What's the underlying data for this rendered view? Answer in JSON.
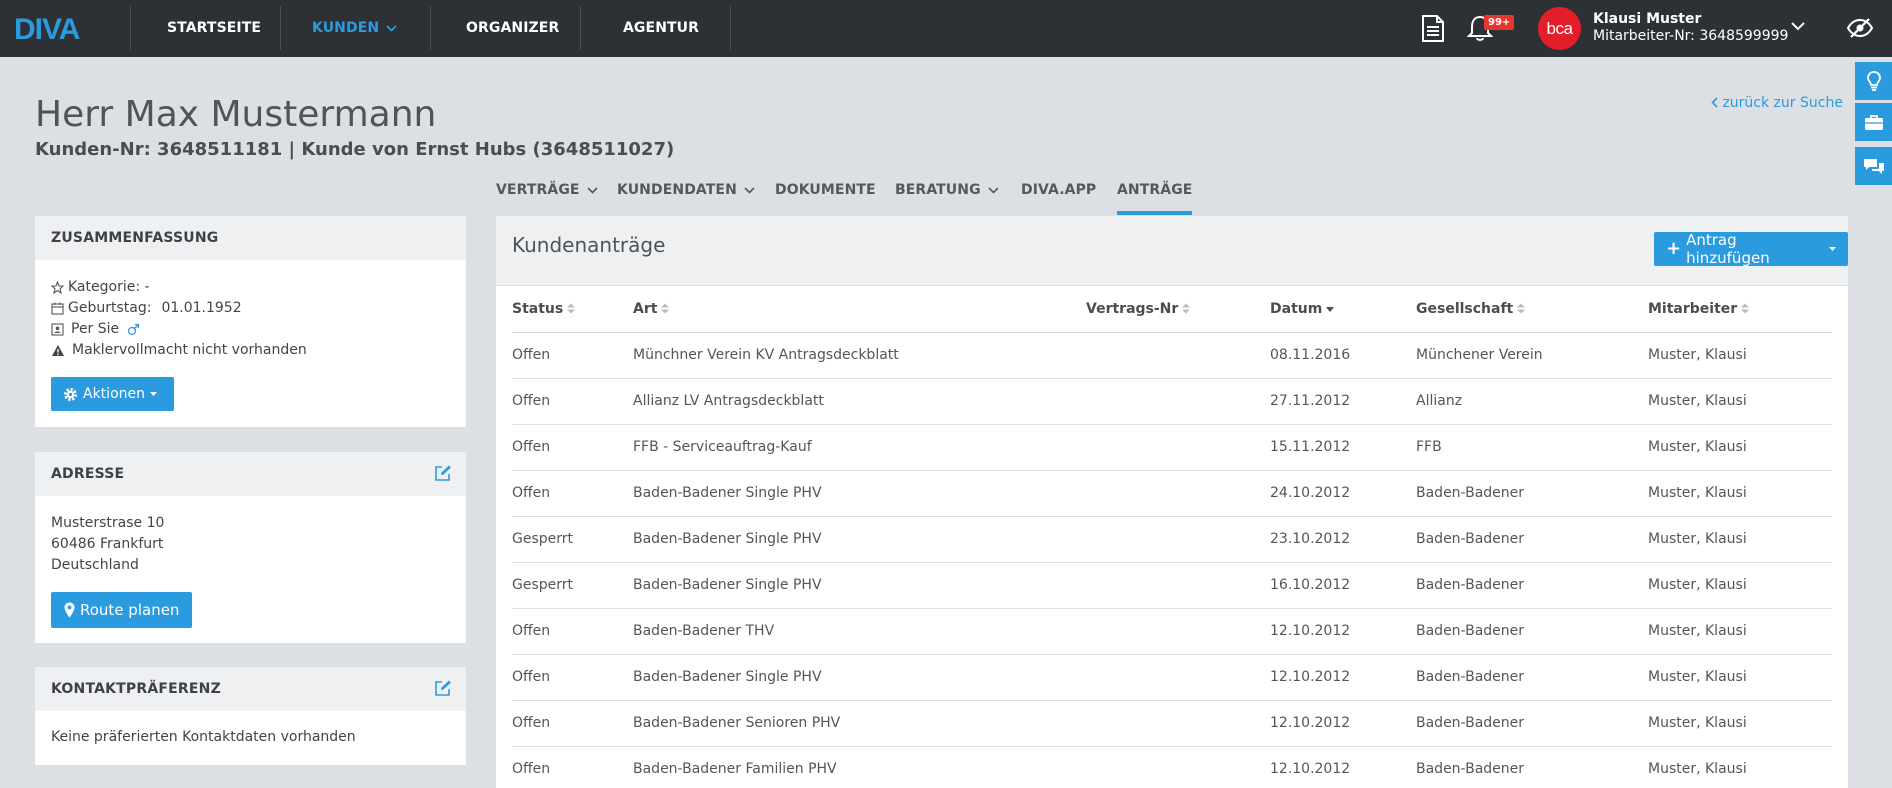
{
  "brand": {
    "logo_text": "DIVA",
    "accent": "#2b9be0",
    "topbar_bg": "#2d3136"
  },
  "nav": [
    {
      "label": "STARTSEITE"
    },
    {
      "label": "KUNDEN"
    },
    {
      "label": "ORGANIZER"
    },
    {
      "label": "AGENTUR"
    }
  ],
  "topbar": {
    "notification_badge": "99+",
    "avatar_text": "bca",
    "user_name": "Klausi Muster",
    "user_id": "Mitarbeiter-Nr: 3648599999",
    "icons": [
      "document-icon",
      "bell-icon",
      "chevron-down-icon",
      "eye-slash-icon"
    ]
  },
  "side_tools": [
    "lightbulb-icon",
    "briefcase-icon",
    "chat-icon"
  ],
  "customer": {
    "title": "Herr Max Mustermann",
    "subtitle": "Kunden-Nr: 3648511181 | Kunde von Ernst Hubs (3648511027)",
    "back_link": "zurück zur Suche"
  },
  "tabs": [
    {
      "label": "VERTRÄGE"
    },
    {
      "label": "KUNDENDATEN"
    },
    {
      "label": "DOKUMENTE"
    },
    {
      "label": "BERATUNG"
    },
    {
      "label": "DIVA.APP"
    },
    {
      "label": "ANTRÄGE"
    }
  ],
  "summary": {
    "heading": "ZUSAMMENFASSUNG",
    "kategorie": "Kategorie: -",
    "geburtstag_label": "Geburtstag:",
    "geburtstag_value": "01.01.1952",
    "anrede": "Per Sie",
    "vollmacht": "Maklervollmacht nicht vorhanden",
    "actions_button": "Aktionen"
  },
  "address": {
    "heading": "ADRESSE",
    "street": "Musterstrase 10",
    "city": "60486 Frankfurt",
    "country": "Deutschland",
    "route_button": "Route planen"
  },
  "contact": {
    "heading": "KONTAKTPRÄFERENZ",
    "text": "Keine präferierten Kontaktdaten vorhanden"
  },
  "applications": {
    "title": "Kundenanträge",
    "add_button": "Antrag hinzufügen",
    "columns": [
      "Status",
      "Art",
      "Vertrags-Nr",
      "Datum",
      "Gesellschaft",
      "Mitarbeiter"
    ],
    "rows": [
      [
        "Offen",
        "Münchner Verein KV Antragsdeckblatt",
        "",
        "08.11.2016",
        "Münchener Verein",
        "Muster, Klausi"
      ],
      [
        "Offen",
        "Allianz LV Antragsdeckblatt",
        "",
        "27.11.2012",
        "Allianz",
        "Muster, Klausi"
      ],
      [
        "Offen",
        "FFB - Serviceauftrag-Kauf",
        "",
        "15.11.2012",
        "FFB",
        "Muster, Klausi"
      ],
      [
        "Offen",
        "Baden-Badener Single PHV",
        "",
        "24.10.2012",
        "Baden-Badener",
        "Muster, Klausi"
      ],
      [
        "Gesperrt",
        "Baden-Badener Single PHV",
        "",
        "23.10.2012",
        "Baden-Badener",
        "Muster, Klausi"
      ],
      [
        "Gesperrt",
        "Baden-Badener Single PHV",
        "",
        "16.10.2012",
        "Baden-Badener",
        "Muster, Klausi"
      ],
      [
        "Offen",
        "Baden-Badener THV",
        "",
        "12.10.2012",
        "Baden-Badener",
        "Muster, Klausi"
      ],
      [
        "Offen",
        "Baden-Badener Single PHV",
        "",
        "12.10.2012",
        "Baden-Badener",
        "Muster, Klausi"
      ],
      [
        "Offen",
        "Baden-Badener Senioren PHV",
        "",
        "12.10.2012",
        "Baden-Badener",
        "Muster, Klausi"
      ],
      [
        "Offen",
        "Baden-Badener Familien PHV",
        "",
        "12.10.2012",
        "Baden-Badener",
        "Muster, Klausi"
      ]
    ]
  }
}
